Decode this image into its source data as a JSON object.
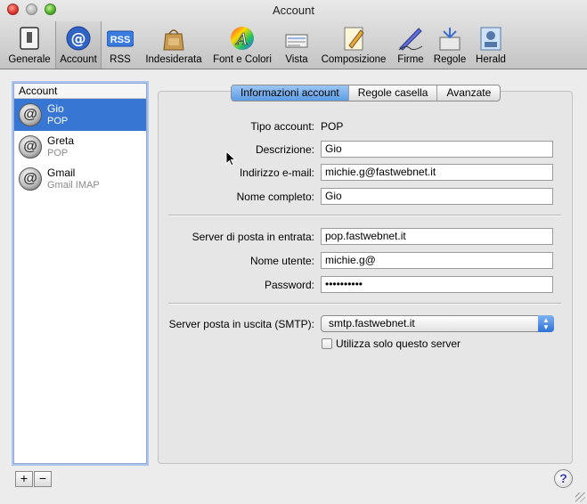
{
  "window": {
    "title": "Account"
  },
  "toolbar": {
    "items": [
      {
        "label": "Generale",
        "icon": "general-switch-icon"
      },
      {
        "label": "Account",
        "icon": "at-sign-icon"
      },
      {
        "label": "RSS",
        "icon": "rss-icon"
      },
      {
        "label": "Indesiderata",
        "icon": "junk-bag-icon"
      },
      {
        "label": "Font e Colori",
        "icon": "font-color-icon"
      },
      {
        "label": "Vista",
        "icon": "view-icon"
      },
      {
        "label": "Composizione",
        "icon": "compose-icon"
      },
      {
        "label": "Firme",
        "icon": "signature-pen-icon"
      },
      {
        "label": "Regole",
        "icon": "rules-icon"
      },
      {
        "label": "Herald",
        "icon": "herald-icon"
      }
    ],
    "selected": "Account",
    "rss_badge": "RSS"
  },
  "sidebar": {
    "header": "Account",
    "accounts": [
      {
        "name": "Gio",
        "type": "POP"
      },
      {
        "name": "Greta",
        "type": "POP"
      },
      {
        "name": "Gmail",
        "type": "Gmail IMAP"
      }
    ],
    "add_label": "+",
    "remove_label": "−"
  },
  "tabs": [
    {
      "label": "Informazioni account"
    },
    {
      "label": "Regole casella"
    },
    {
      "label": "Avanzate"
    }
  ],
  "form": {
    "account_type_label": "Tipo account:",
    "account_type_value": "POP",
    "description_label": "Descrizione:",
    "description_value": "Gio",
    "email_label": "Indirizzo e-mail:",
    "email_value": "michie.g@fastwebnet.it",
    "fullname_label": "Nome completo:",
    "fullname_value": "Gio",
    "incoming_label": "Server di posta in entrata:",
    "incoming_value": "pop.fastwebnet.it",
    "username_label": "Nome utente:",
    "username_value": "michie.g@",
    "password_label": "Password:",
    "password_value": "••••••••••",
    "smtp_label": "Server posta in uscita (SMTP):",
    "smtp_value": "smtp.fastwebnet.it",
    "only_server_label": "Utilizza solo questo server",
    "only_server_checked": false
  },
  "help_label": "?",
  "colors": {
    "selection": "#3876d3",
    "tab_selected": "#5d9ce5"
  }
}
